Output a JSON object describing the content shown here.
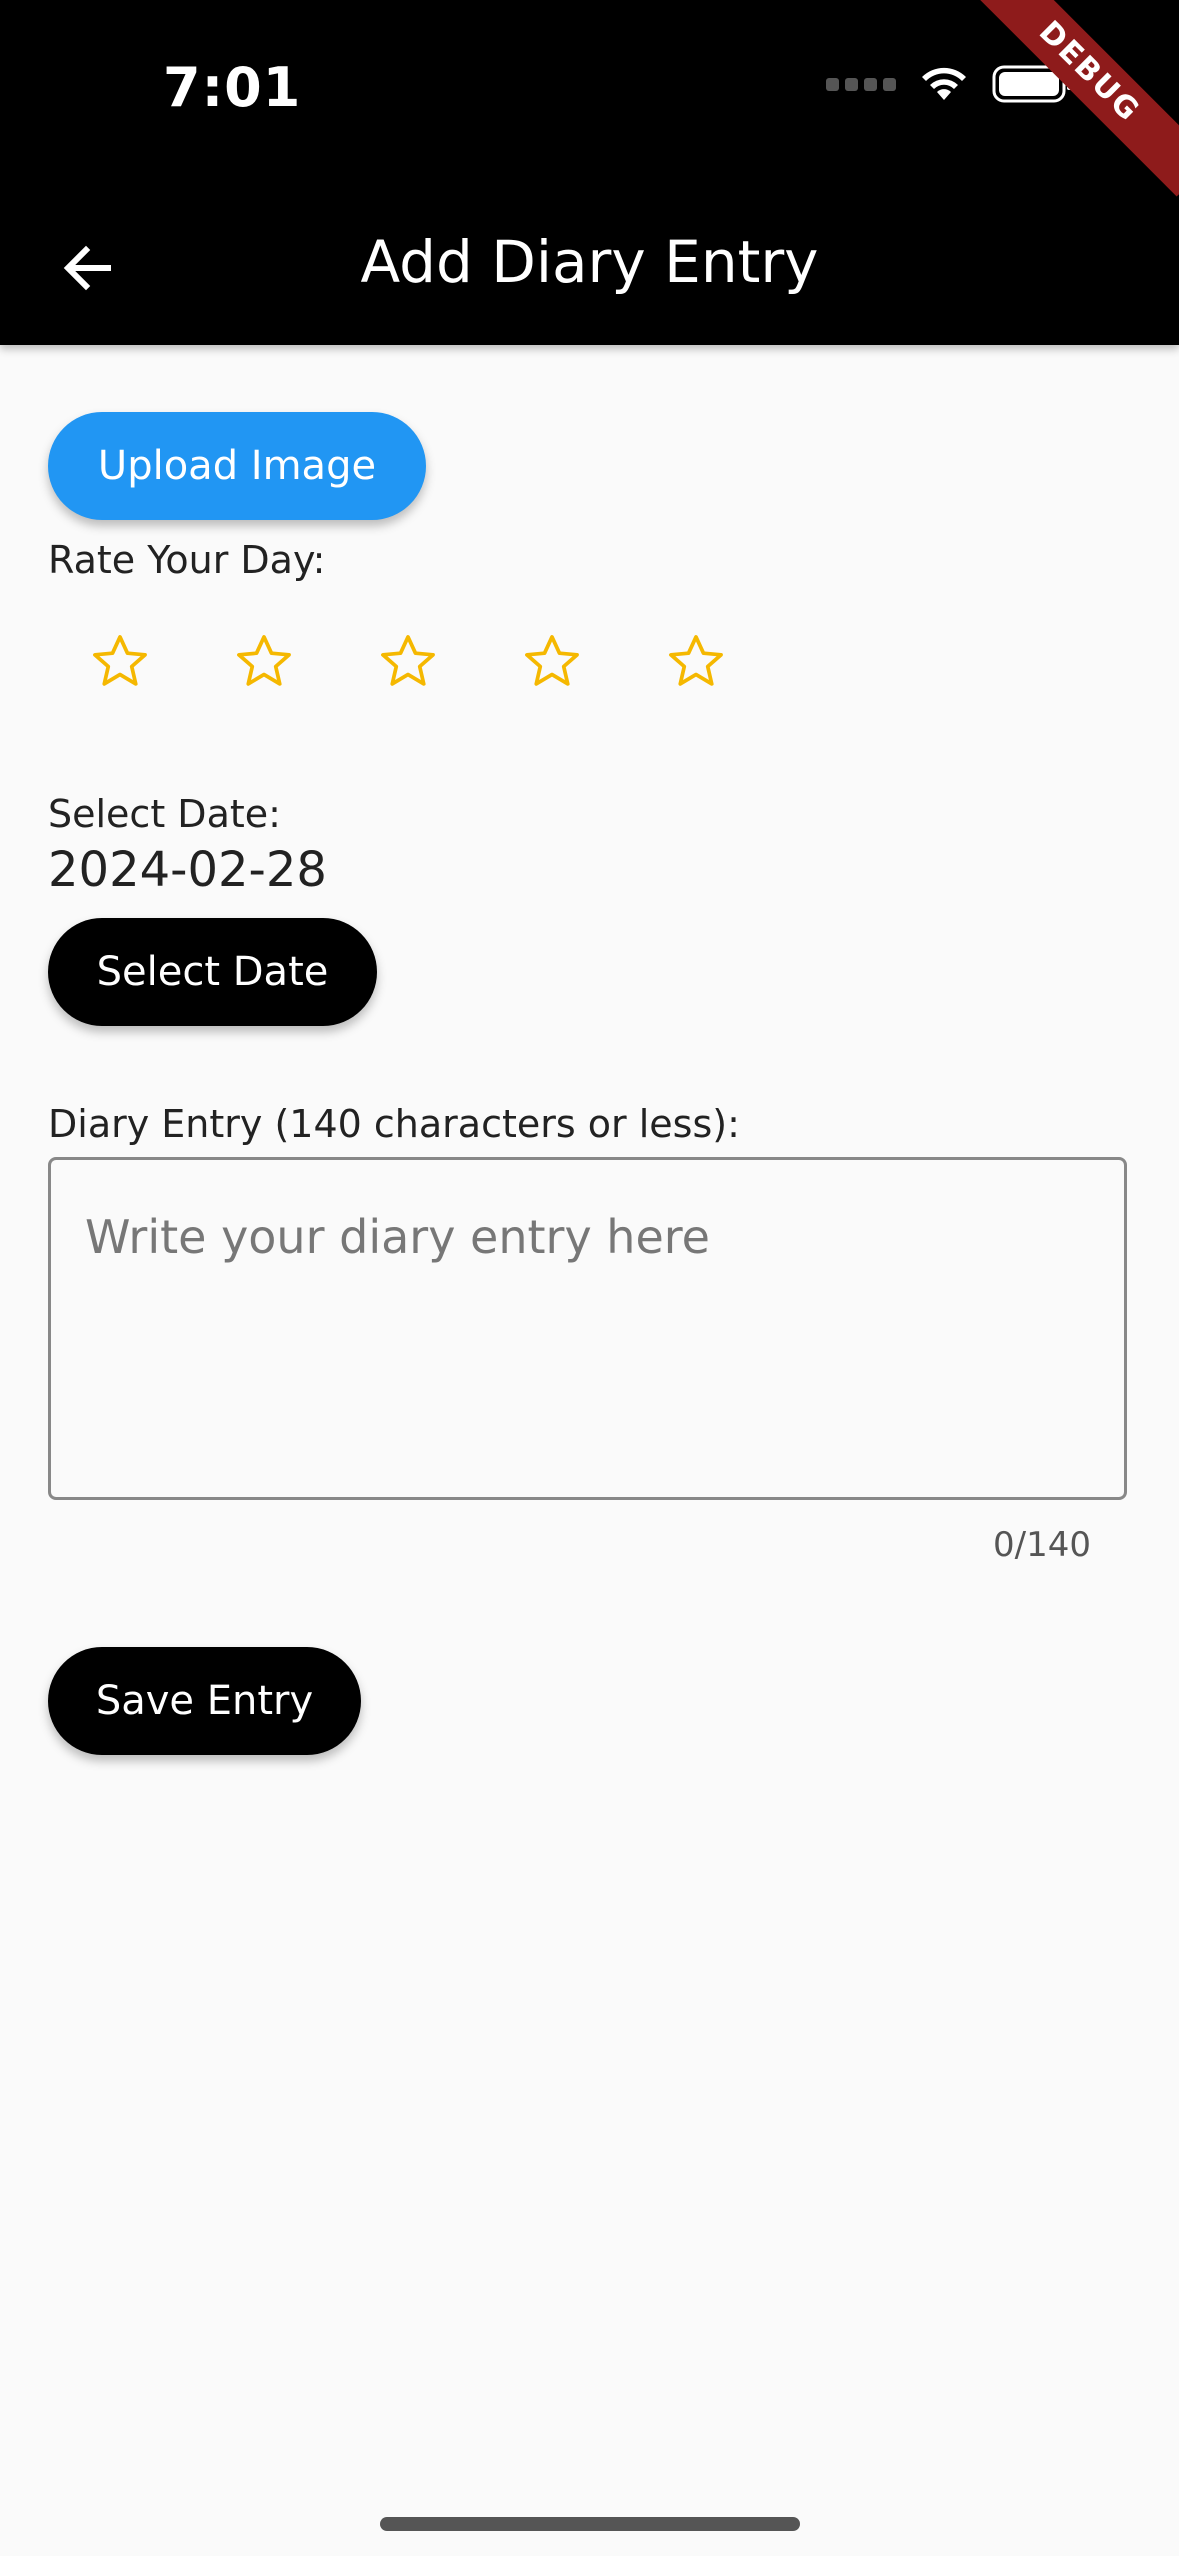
{
  "status_bar": {
    "time": "7:01",
    "debug_label": "DEBUG"
  },
  "app_bar": {
    "title": "Add Diary Entry",
    "back_icon": "arrow-back-icon"
  },
  "upload": {
    "label": "Upload Image"
  },
  "rating": {
    "label": "Rate Your Day:",
    "max": 5,
    "value": 0,
    "star_color": "#f5b800"
  },
  "date": {
    "label": "Select Date:",
    "value": "2024-02-28",
    "button_label": "Select Date"
  },
  "entry": {
    "label": "Diary Entry (140 characters or less):",
    "placeholder": "Write your diary entry here",
    "value": "",
    "counter": "0/140"
  },
  "save": {
    "label": "Save Entry"
  },
  "colors": {
    "primary": "#2196f3",
    "app_bar": "#000000",
    "background": "#fafafa"
  }
}
